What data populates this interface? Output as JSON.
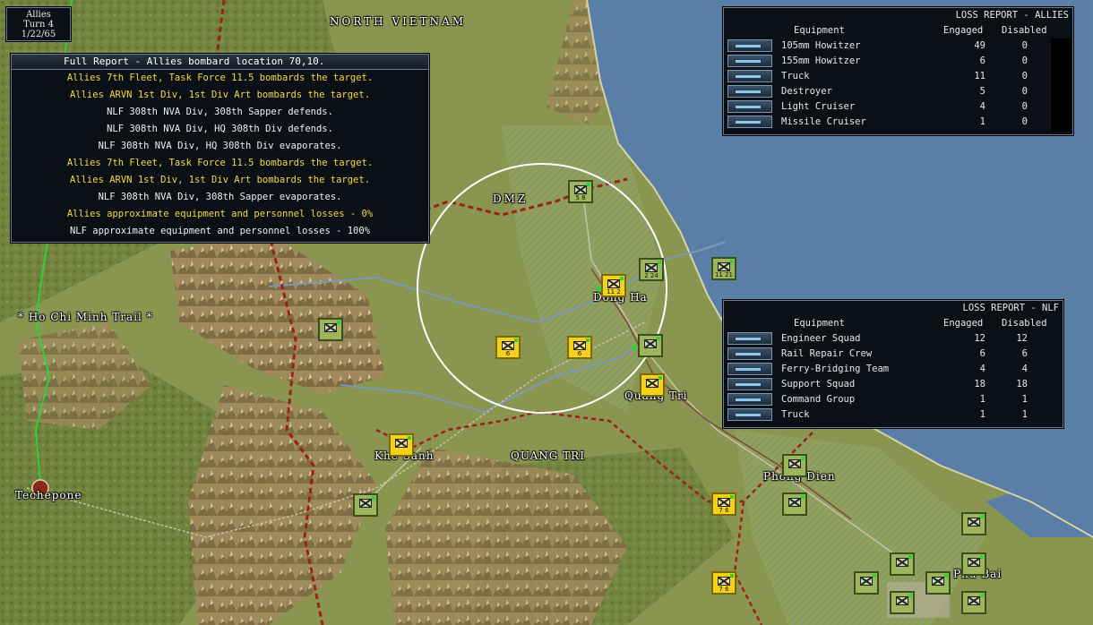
{
  "turn_box": {
    "side": "Allies",
    "turn": "Turn 4",
    "date": "1/22/65"
  },
  "full_report": {
    "header": "Full Report -  Allies bombard location 70,10.",
    "lines": [
      {
        "side": "allies",
        "text": "Allies 7th Fleet, Task Force 11.5 bombards the target."
      },
      {
        "side": "allies",
        "text": "Allies ARVN 1st Div, 1st Div Art bombards the target."
      },
      {
        "side": "nlf",
        "text": "NLF 308th NVA Div, 308th Sapper defends."
      },
      {
        "side": "nlf",
        "text": "NLF 308th NVA Div, HQ 308th Div defends."
      },
      {
        "side": "nlf",
        "text": "NLF 308th NVA Div, HQ 308th Div evaporates."
      },
      {
        "side": "allies",
        "text": "Allies 7th Fleet, Task Force 11.5 bombards the target."
      },
      {
        "side": "allies",
        "text": "Allies ARVN 1st Div, 1st Div Art bombards the target."
      },
      {
        "side": "nlf",
        "text": "NLF 308th NVA Div, 308th Sapper evaporates."
      },
      {
        "side": "allies",
        "text": "Allies approximate equipment and personnel losses - 0%"
      },
      {
        "side": "nlf",
        "text": "NLF approximate equipment and personnel losses - 100%"
      }
    ]
  },
  "loss_allies": {
    "title": "LOSS REPORT -  ALLIES",
    "col_equipment": "Equipment",
    "col_engaged": "Engaged",
    "col_disabled": "Disabled",
    "rows": [
      {
        "icon": "howitzer-icon",
        "name": "105mm Howitzer",
        "engaged": "49",
        "disabled": "0"
      },
      {
        "icon": "howitzer-icon",
        "name": "155mm Howitzer",
        "engaged": "6",
        "disabled": "0"
      },
      {
        "icon": "truck-icon",
        "name": "Truck",
        "engaged": "11",
        "disabled": "0"
      },
      {
        "icon": "ship-icon",
        "name": "Destroyer",
        "engaged": "5",
        "disabled": "0"
      },
      {
        "icon": "ship-icon",
        "name": "Light Cruiser",
        "engaged": "4",
        "disabled": "0"
      },
      {
        "icon": "ship-icon",
        "name": "Missile Cruiser",
        "engaged": "1",
        "disabled": "0"
      }
    ]
  },
  "loss_nlf": {
    "title": "LOSS REPORT -  NLF",
    "col_equipment": "Equipment",
    "col_engaged": "Engaged",
    "col_disabled": "Disabled",
    "rows": [
      {
        "icon": "engineer-icon",
        "name": "Engineer Squad",
        "engaged": "12",
        "disabled": "12"
      },
      {
        "icon": "engineer-icon",
        "name": "Rail Repair Crew",
        "engaged": "6",
        "disabled": "6"
      },
      {
        "icon": "engineer-icon",
        "name": "Ferry-Bridging Team",
        "engaged": "4",
        "disabled": "4"
      },
      {
        "icon": "soldier-icon",
        "name": "Support Squad",
        "engaged": "18",
        "disabled": "18"
      },
      {
        "icon": "soldier-icon",
        "name": "Command Group",
        "engaged": "1",
        "disabled": "1"
      },
      {
        "icon": "truck-icon",
        "name": "Truck",
        "engaged": "1",
        "disabled": "1"
      }
    ]
  },
  "map_labels": {
    "north_vietnam": "NORTH VIETNAM",
    "dmz": "DMZ",
    "ho_chi_minh_trail": "* Ho Chi Minh Trail *",
    "dong_ha": "Dong Ha",
    "quang_tri_city": "Quang Tri",
    "khe_sanh": "Khe Sanh",
    "quang_tri_province": "QUANG TRI",
    "tchepone": "Techepone",
    "phong_dien": "Phong Dien",
    "hue": "Phu Bai"
  },
  "colors": {
    "allied_unit": "#f4d21c",
    "nlf_unit": "#9db55c",
    "sea": "#5a7fa6",
    "border_line": "#9a2018",
    "trail": "#2ad43a"
  }
}
